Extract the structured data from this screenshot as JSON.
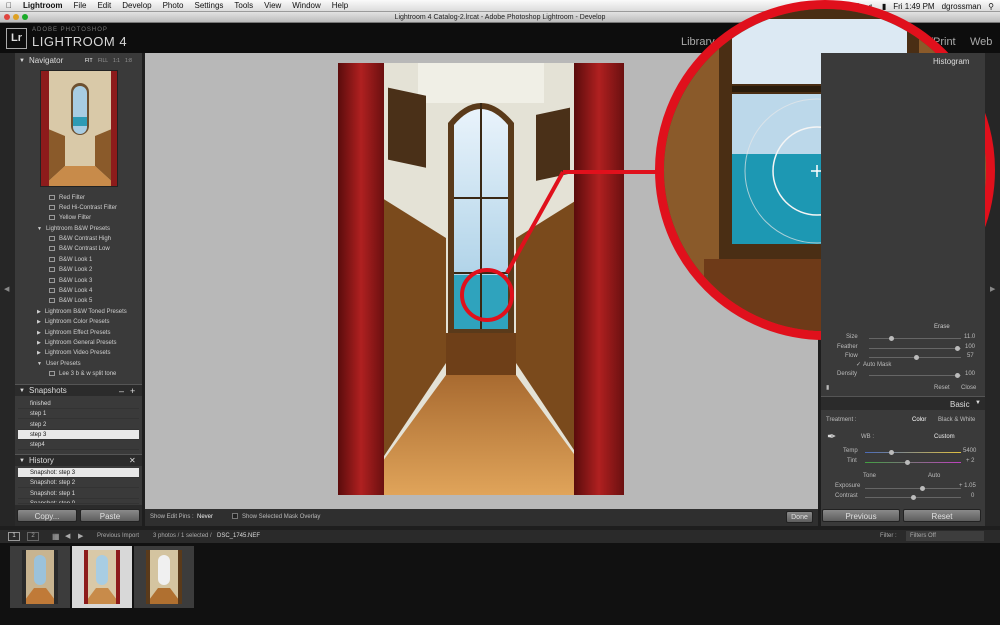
{
  "menubar": {
    "app": "Lightroom",
    "items": [
      "File",
      "Edit",
      "Develop",
      "Photo",
      "Settings",
      "Tools",
      "View",
      "Window",
      "Help"
    ],
    "time": "Fri 1:49 PM",
    "user": "dgrossman"
  },
  "window_title": "Lightroom 4 Catalog-2.lrcat - Adobe Photoshop Lightroom - Develop",
  "header": {
    "logo": "Lr",
    "brand_small": "ADOBE PHOTOSHOP",
    "brand": "LIGHTROOM 4",
    "modules": [
      "Library",
      "Print",
      "Web"
    ]
  },
  "navigator": {
    "title": "Navigator",
    "zoom_options": [
      "FIT",
      "FILL",
      "1:1",
      "1:8"
    ]
  },
  "presets": {
    "items": [
      "Red Filter",
      "Red Hi-Contrast Filter",
      "Yellow Filter"
    ],
    "group_bw": "Lightroom B&W Presets",
    "bw_items": [
      "B&W Contrast High",
      "B&W Contrast Low",
      "B&W Look 1",
      "B&W Look 2",
      "B&W Look 3",
      "B&W Look 4",
      "B&W Look 5"
    ],
    "groups": [
      "Lightroom B&W Toned Presets",
      "Lightroom Color Presets",
      "Lightroom Effect Presets",
      "Lightroom General Presets",
      "Lightroom Video Presets"
    ],
    "user_group": "User Presets",
    "user_items": [
      "Lee 3 b & w split tone"
    ]
  },
  "snapshots": {
    "title": "Snapshots",
    "items": [
      "finished",
      "step 1",
      "step 2",
      "step 3",
      "step4"
    ],
    "selected": "step 3"
  },
  "history": {
    "title": "History",
    "items": [
      "Snapshot: step 3",
      "Snapshot: step 2",
      "Snapshot: step 1",
      "Snapshot: step 0"
    ]
  },
  "left_buttons": {
    "copy": "Copy...",
    "paste": "Paste"
  },
  "editbar": {
    "show_edit_pins_label": "Show Edit Pins :",
    "show_edit_pins_value": "Never",
    "show_mask_label": "Show Selected Mask Overlay",
    "done": "Done"
  },
  "right_panel": {
    "histogram": "Histogram",
    "brush": {
      "erase": "Erase",
      "size_label": "Size",
      "size_value": "11.0",
      "feather_label": "Feather",
      "feather_value": "100",
      "flow_label": "Flow",
      "flow_value": "57",
      "auto_mask": "Auto Mask",
      "density_label": "Density",
      "density_value": "100",
      "reset": "Reset",
      "close": "Close"
    },
    "basic": {
      "title": "Basic",
      "treatment_label": "Treatment :",
      "color": "Color",
      "bw": "Black & White",
      "wb_label": "WB :",
      "wb_value": "Custom",
      "temp_label": "Temp",
      "temp_value": "5400",
      "tint_label": "Tint",
      "tint_value": "+ 2",
      "tone_label": "Tone",
      "auto": "Auto",
      "exposure_label": "Exposure",
      "exposure_value": "+ 1.05",
      "contrast_label": "Contrast",
      "contrast_value": "0"
    },
    "previous": "Previous",
    "reset": "Reset"
  },
  "filmbar": {
    "screen1": "1",
    "screen2": "2",
    "source": "Previous Import",
    "count": "3 photos / 1 selected /",
    "filename": "DSC_1745.NEF",
    "filter_label": "Filter :",
    "filter_value": "Filters Off"
  },
  "colors": {
    "accent_red": "#e0101c",
    "panel": "#3a3a3a",
    "canvas": "#b8b8b8"
  }
}
